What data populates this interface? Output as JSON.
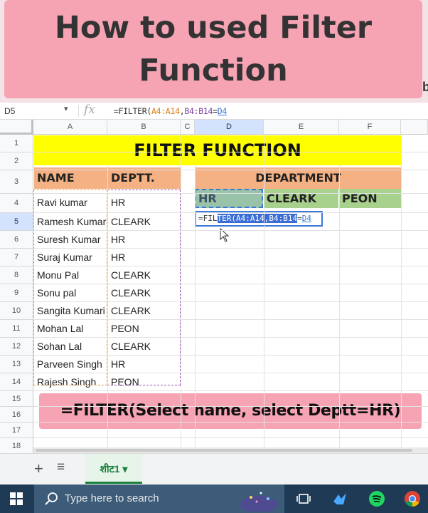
{
  "banner": {
    "title": "How to used Filter\nFunction"
  },
  "edge_fragments": {
    "right_b": "b"
  },
  "formula_bar": {
    "name_box": "D5",
    "fx_label": "fx",
    "prefix": "=FILTER(",
    "arg1": "A4:A14",
    "sep1": ",",
    "arg2": "B4:B14",
    "eq": "=",
    "arg3": "D4"
  },
  "columns": [
    "A",
    "B",
    "C",
    "D",
    "E",
    "F"
  ],
  "rows": [
    "1",
    "2",
    "3",
    "4",
    "5",
    "6",
    "7",
    "8",
    "9",
    "10",
    "11",
    "12",
    "13",
    "14",
    "15",
    "16",
    "17",
    "18"
  ],
  "sheet": {
    "title": "FILTER FUNCTION",
    "name_header": "NAME",
    "deptt_header": "DEPTT.",
    "department_header": "DEPARTMENT",
    "dept_options": [
      "HR",
      "CLEARK",
      "PEON"
    ],
    "records": [
      {
        "name": "Ravi kumar",
        "dept": "HR"
      },
      {
        "name": "Ramesh Kumar",
        "dept": "CLEARK"
      },
      {
        "name": "Suresh Kumar",
        "dept": "HR"
      },
      {
        "name": "Suraj Kumar",
        "dept": "HR"
      },
      {
        "name": "Monu Pal",
        "dept": "CLEARK"
      },
      {
        "name": "Sonu pal",
        "dept": "CLEARK"
      },
      {
        "name": "Sangita Kumari",
        "dept": "CLEARK"
      },
      {
        "name": "Mohan Lal",
        "dept": "PEON"
      },
      {
        "name": "Sohan Lal",
        "dept": "CLEARK"
      },
      {
        "name": "Parveen Singh",
        "dept": "HR"
      },
      {
        "name": "Rajesh Singh",
        "dept": "PEON"
      }
    ],
    "editing_cell": {
      "plain": "=FIL",
      "highlighted": "TER(A4:A14,B4:B14",
      "eq": "=",
      "ref": "D4"
    }
  },
  "hint": "=FILTER(Select name, select Deptt=HR)",
  "tabs": {
    "add": "+",
    "all": "≡",
    "sheet_name": "शीट1",
    "dropdown": "▾"
  },
  "taskbar": {
    "search_placeholder": "Type here to search"
  }
}
